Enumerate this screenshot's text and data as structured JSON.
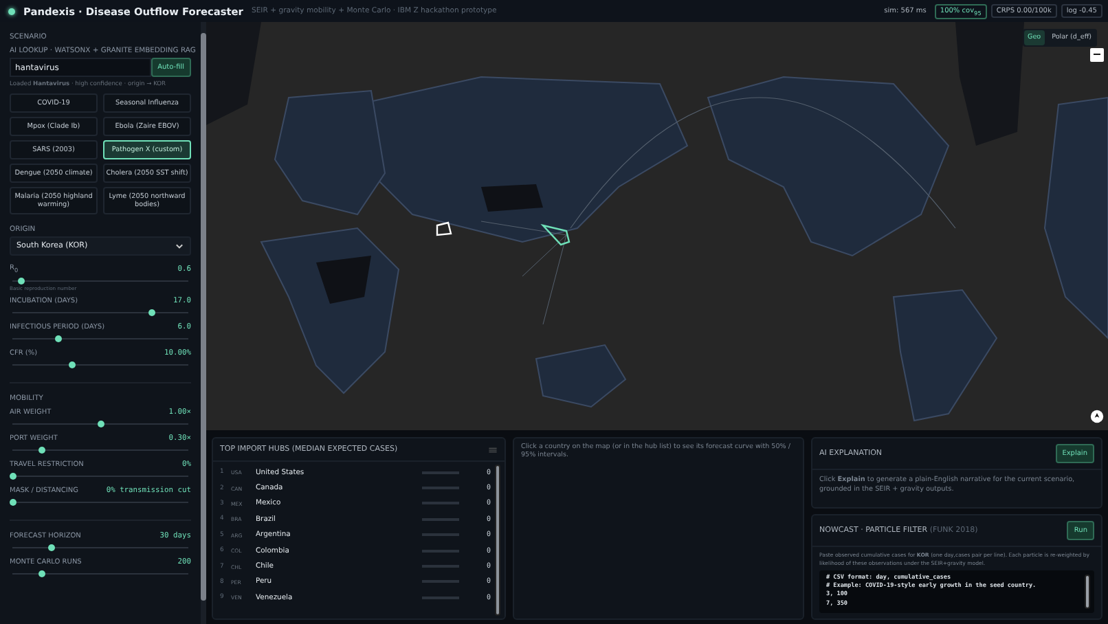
{
  "header": {
    "title": "Pandexis · Disease Outflow Forecaster",
    "subtitle": "SEIR + gravity mobility + Monte Carlo · IBM Z hackathon prototype",
    "stats": [
      {
        "text": "sim: 567 ms",
        "kind": "plain"
      },
      {
        "text": "100% cov$_{95}$",
        "kind": "good"
      },
      {
        "text": "CRPS 0.00/100k",
        "kind": "box"
      },
      {
        "text": "log -0.45",
        "kind": "box"
      }
    ]
  },
  "sidebar": {
    "section": "SCENARIO",
    "ai_label": "AI LOOKUP · WATSONX + GRANITE EMBEDDING RAG",
    "lookup": {
      "value": "hantavirus",
      "button": "Auto-fill"
    },
    "status": "Loaded **Hantavirus** · high confidence · origin → KOR",
    "presets": [
      {
        "label": "COVID-19",
        "selected": false
      },
      {
        "label": "Seasonal Influenza",
        "selected": false
      },
      {
        "label": "Mpox (Clade Ib)",
        "selected": false
      },
      {
        "label": "Ebola (Zaire EBOV)",
        "selected": false
      },
      {
        "label": "SARS (2003)",
        "selected": false
      },
      {
        "label": "Pathogen X (custom)",
        "selected": true
      },
      {
        "label": "Dengue (2050 climate)",
        "selected": false
      },
      {
        "label": "Cholera (2050 SST shift)",
        "selected": false
      },
      {
        "label": "Malaria (2050 highland warming)",
        "selected": false
      },
      {
        "label": "Lyme (2050 northward bodies)",
        "selected": false
      }
    ],
    "origin": {
      "label": "ORIGIN",
      "value": "South Korea (KOR)"
    },
    "groups": [
      {
        "sliders": [
          {
            "label": "R$_{0}$",
            "reading": "0.6",
            "level": 0.05,
            "hint": "Basic reproduction number"
          },
          {
            "label": "INCUBATION (DAYS)",
            "reading": "17.0",
            "level": 0.79
          },
          {
            "label": "INFECTIOUS PERIOD (DAYS)",
            "reading": "6.0",
            "level": 0.26
          },
          {
            "label": "CFR (%)",
            "reading": "10.00%",
            "level": 0.34
          }
        ]
      },
      {
        "title": "MOBILITY",
        "sliders": [
          {
            "label": "AIR WEIGHT",
            "reading": "1.00×",
            "level": 0.5
          },
          {
            "label": "PORT WEIGHT",
            "reading": "0.30×",
            "level": 0.17
          },
          {
            "label": "TRAVEL RESTRICTION",
            "reading": "0%",
            "level": 0
          },
          {
            "label": "MASK / DISTANCING",
            "reading": "0% transmission cut",
            "level": 0
          }
        ]
      },
      {
        "sliders": [
          {
            "label": "FORECAST HORIZON",
            "reading": "30 days",
            "level": 0.22
          },
          {
            "label": "MONTE CARLO RUNS",
            "reading": "200",
            "level": 0.17
          }
        ]
      }
    ]
  },
  "map": {
    "kind": "picture",
    "views": [
      {
        "label": "Geo",
        "selected": true
      },
      {
        "label": "Polar (d_eff)",
        "selected": false
      }
    ],
    "zoom_out": "−"
  },
  "hubs": {
    "title": "TOP IMPORT HUBS (MEDIAN EXPECTED CASES)",
    "rows": [
      {
        "rank": "1",
        "code": "USA",
        "name": "United States",
        "value": "0"
      },
      {
        "rank": "2",
        "code": "CAN",
        "name": "Canada",
        "value": "0"
      },
      {
        "rank": "3",
        "code": "MEX",
        "name": "Mexico",
        "value": "0"
      },
      {
        "rank": "4",
        "code": "BRA",
        "name": "Brazil",
        "value": "0"
      },
      {
        "rank": "5",
        "code": "ARG",
        "name": "Argentina",
        "value": "0"
      },
      {
        "rank": "6",
        "code": "COL",
        "name": "Colombia",
        "value": "0"
      },
      {
        "rank": "7",
        "code": "CHL",
        "name": "Chile",
        "value": "0"
      },
      {
        "rank": "8",
        "code": "PER",
        "name": "Peru",
        "value": "0"
      },
      {
        "rank": "9",
        "code": "VEN",
        "name": "Venezuela",
        "value": "0"
      }
    ]
  },
  "forecast": {
    "hint": "Click a country on the map (or in the hub list) to see its forecast curve with 50% / 95% intervals."
  },
  "explanation": {
    "title": "AI EXPLANATION",
    "button": "Explain",
    "text": "Click **Explain** to generate a plain-English narrative for the current scenario, grounded in the SEIR + gravity outputs."
  },
  "nowcast": {
    "title": "NOWCAST · PARTICLE FILTER",
    "title_note": "(FUNK 2018)",
    "button": "Run",
    "text": "Paste observed cumulative cases for **KOR** (one day,cases pair per line). Each particle is re-weighted by likelihood of these observations under the SEIR+gravity model.",
    "lines": [
      "# CSV format: day, cumulative_cases",
      "# Example: COVID-19-style early growth in the seed country.",
      "3, 100",
      "7, 350"
    ]
  }
}
